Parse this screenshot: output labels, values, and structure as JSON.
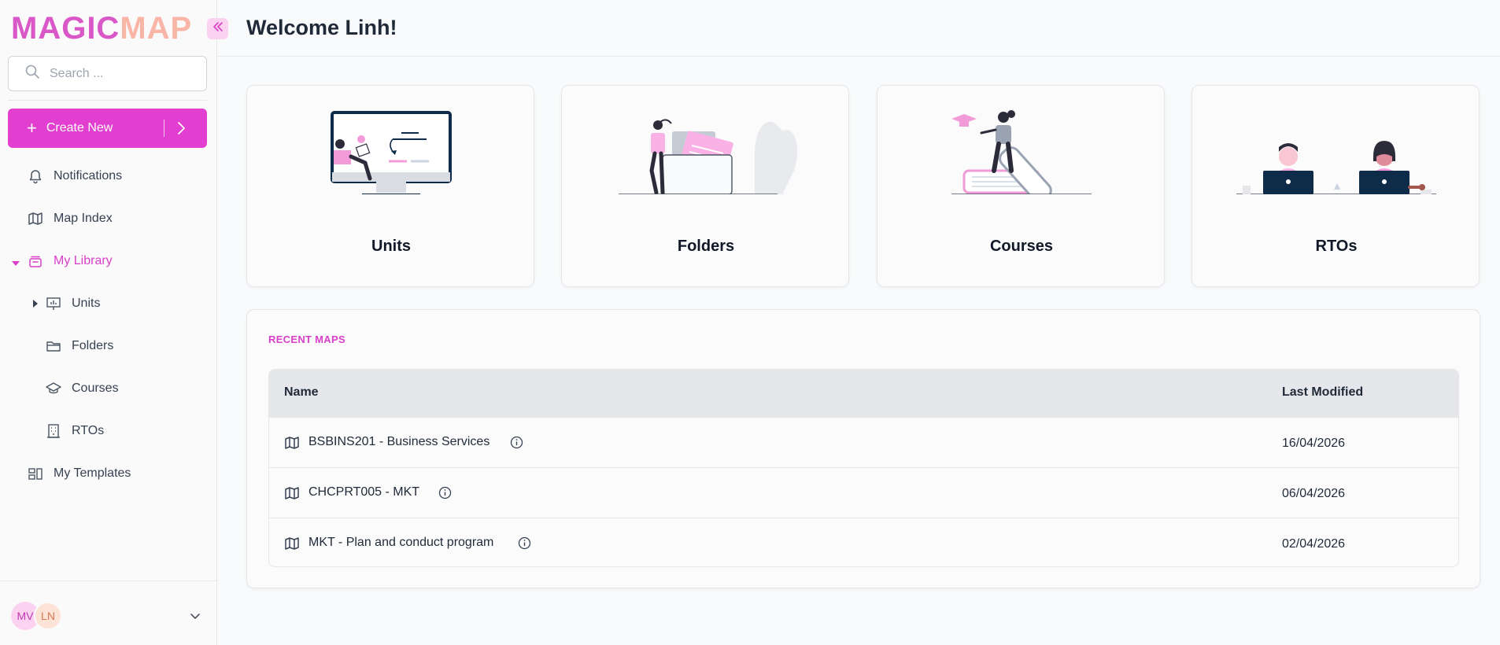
{
  "app": {
    "logo_part1": "MAGIC",
    "logo_part2": "MAP"
  },
  "sidebar": {
    "search_placeholder": "Search ...",
    "create_label": "Create New",
    "nav": {
      "notifications": "Notifications",
      "map_index": "Map Index",
      "my_library": "My Library",
      "units": "Units",
      "folders": "Folders",
      "courses": "Courses",
      "rtos": "RTOs",
      "my_templates": "My Templates"
    },
    "avatars": [
      "MV",
      "LN"
    ]
  },
  "header": {
    "title": "Welcome Linh!"
  },
  "cards": [
    {
      "label": "Units",
      "icon": "units-illustration"
    },
    {
      "label": "Folders",
      "icon": "folders-illustration"
    },
    {
      "label": "Courses",
      "icon": "courses-illustration"
    },
    {
      "label": "RTOs",
      "icon": "rtos-illustration"
    }
  ],
  "recent": {
    "title": "RECENT MAPS",
    "columns": [
      "Name",
      "Last Modified"
    ],
    "rows": [
      {
        "name": "BSBINS201 - Business Services",
        "modified": "16/04/2026"
      },
      {
        "name": "CHCPRT005 - MKT",
        "modified": "06/04/2026"
      },
      {
        "name": "MKT - Plan and conduct program",
        "modified": "02/04/2026"
      }
    ]
  },
  "colors": {
    "accent": "#e23ecf",
    "accent_text": "#d93fc8",
    "logo_secondary": "#f9b6a6"
  }
}
